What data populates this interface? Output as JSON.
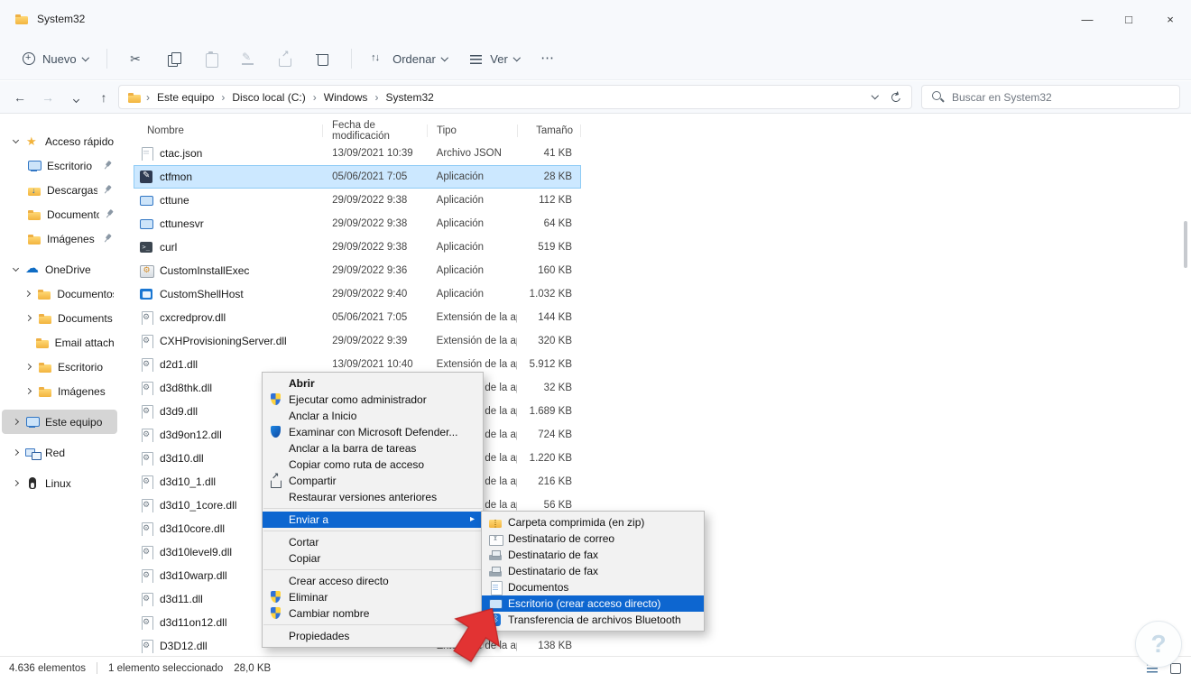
{
  "window": {
    "title": "System32",
    "controls": {
      "minimize": "—",
      "maximize": "□",
      "close": "×"
    }
  },
  "toolbar": {
    "new_label": "Nuevo",
    "sort_label": "Ordenar",
    "view_label": "Ver",
    "more_label": "⋯",
    "buttons": [
      {
        "icon": "cut",
        "enabled": true
      },
      {
        "icon": "copy",
        "enabled": true
      },
      {
        "icon": "paste",
        "enabled": false
      },
      {
        "icon": "rename",
        "enabled": false
      },
      {
        "icon": "share",
        "enabled": false
      },
      {
        "icon": "delete",
        "enabled": true
      }
    ]
  },
  "nav": {
    "buttons": [
      "back-arrow",
      "forward-arrow",
      "recent-locations-chevron",
      "up-arrow"
    ]
  },
  "address": {
    "crumbs": [
      "Este equipo",
      "Disco local (C:)",
      "Windows",
      "System32"
    ],
    "separator": "›",
    "search_placeholder": "Buscar en System32"
  },
  "sidebar": {
    "items": [
      {
        "label": "Acceso rápido",
        "icon": "star",
        "chevron": "down",
        "indent": 0
      },
      {
        "label": "Escritorio",
        "icon": "monitor",
        "indent": 1,
        "pinned": true
      },
      {
        "label": "Descargas",
        "icon": "folder-down",
        "indent": 1,
        "pinned": true
      },
      {
        "label": "Documentos",
        "icon": "folder",
        "indent": 1,
        "pinned": true
      },
      {
        "label": "Imágenes",
        "icon": "folder",
        "indent": 1,
        "pinned": true,
        "gap_after": true
      },
      {
        "label": "OneDrive",
        "icon": "cloud",
        "chevron": "down",
        "indent": 0
      },
      {
        "label": "Documentos",
        "icon": "folder",
        "chevron": "right",
        "indent": 1
      },
      {
        "label": "Documents",
        "icon": "folder",
        "chevron": "right",
        "indent": 1
      },
      {
        "label": "Email attachments",
        "icon": "folder",
        "chevron_spacer": true,
        "indent": 1
      },
      {
        "label": "Escritorio",
        "icon": "folder",
        "chevron": "right",
        "indent": 1
      },
      {
        "label": "Imágenes",
        "icon": "folder",
        "chevron": "right",
        "indent": 1,
        "gap_after": true
      },
      {
        "label": "Este equipo",
        "icon": "pc",
        "chevron": "right",
        "indent": 0,
        "selected": true,
        "gap_after": true
      },
      {
        "label": "Red",
        "icon": "network",
        "chevron": "right",
        "indent": 0,
        "gap_after": true
      },
      {
        "label": "Linux",
        "icon": "linux",
        "chevron": "right",
        "indent": 0
      }
    ]
  },
  "files": {
    "columns": [
      "Nombre",
      "Fecha de modificación",
      "Tipo",
      "Tamaño"
    ],
    "rows": [
      {
        "name": "ctac.json",
        "date": "13/09/2021 10:39",
        "type": "Archivo JSON",
        "size": "41 KB",
        "icon": "file"
      },
      {
        "name": "ctfmon",
        "date": "05/06/2021 7:05",
        "type": "Aplicación",
        "size": "28 KB",
        "icon": "app-pen",
        "selected": true
      },
      {
        "name": "cttune",
        "date": "29/09/2022 9:38",
        "type": "Aplicación",
        "size": "112 KB",
        "icon": "app-monitor"
      },
      {
        "name": "cttunesvr",
        "date": "29/09/2022 9:38",
        "type": "Aplicación",
        "size": "64 KB",
        "icon": "app-monitor"
      },
      {
        "name": "curl",
        "date": "29/09/2022 9:38",
        "type": "Aplicación",
        "size": "519 KB",
        "icon": "app-terminal"
      },
      {
        "name": "CustomInstallExec",
        "date": "29/09/2022 9:36",
        "type": "Aplicación",
        "size": "160 KB",
        "icon": "app-installer"
      },
      {
        "name": "CustomShellHost",
        "date": "29/09/2022 9:40",
        "type": "Aplicación",
        "size": "1.032 KB",
        "icon": "app-window"
      },
      {
        "name": "cxcredprov.dll",
        "date": "05/06/2021 7:05",
        "type": "Extensión de la ap...",
        "size": "144 KB",
        "icon": "dll"
      },
      {
        "name": "CXHProvisioningServer.dll",
        "date": "29/09/2022 9:39",
        "type": "Extensión de la ap...",
        "size": "320 KB",
        "icon": "dll"
      },
      {
        "name": "d2d1.dll",
        "date": "13/09/2021 10:40",
        "type": "Extensión de la ap...",
        "size": "5.912 KB",
        "icon": "dll"
      },
      {
        "name": "d3d8thk.dll",
        "date": "",
        "type": "Extensión de la ap...",
        "size": "32 KB",
        "icon": "dll"
      },
      {
        "name": "d3d9.dll",
        "date": "",
        "type": "Extensión de la ap...",
        "size": "1.689 KB",
        "icon": "dll"
      },
      {
        "name": "d3d9on12.dll",
        "date": "",
        "type": "Extensión de la ap...",
        "size": "724 KB",
        "icon": "dll"
      },
      {
        "name": "d3d10.dll",
        "date": "",
        "type": "Extensión de la ap...",
        "size": "1.220 KB",
        "icon": "dll"
      },
      {
        "name": "d3d10_1.dll",
        "date": "",
        "type": "Extensión de la ap...",
        "size": "216 KB",
        "icon": "dll"
      },
      {
        "name": "d3d10_1core.dll",
        "date": "",
        "type": "Extensión de la ap...",
        "size": "56 KB",
        "icon": "dll"
      },
      {
        "name": "d3d10core.dll",
        "date": "",
        "type": "",
        "size": "",
        "icon": "dll"
      },
      {
        "name": "d3d10level9.dll",
        "date": "",
        "type": "",
        "size": "",
        "icon": "dll"
      },
      {
        "name": "d3d10warp.dll",
        "date": "",
        "type": "",
        "size": "",
        "icon": "dll"
      },
      {
        "name": "d3d11.dll",
        "date": "",
        "type": "",
        "size": "",
        "icon": "dll"
      },
      {
        "name": "d3d11on12.dll",
        "date": "",
        "type": "",
        "size": "",
        "icon": "dll"
      },
      {
        "name": "D3D12.dll",
        "date": "",
        "type": "Extensión de la ap...",
        "size": "138 KB",
        "icon": "dll"
      }
    ]
  },
  "context_menu": {
    "submenu_arrow": "▸",
    "items": [
      {
        "label": "Abrir",
        "bold": true
      },
      {
        "label": "Ejecutar como administrador",
        "icon": "uac-shield"
      },
      {
        "label": "Anclar a Inicio"
      },
      {
        "label": "Examinar con Microsoft Defender...",
        "icon": "defender-shield"
      },
      {
        "label": "Anclar a la barra de tareas"
      },
      {
        "label": "Copiar como ruta de acceso"
      },
      {
        "label": "Compartir",
        "icon": "share"
      },
      {
        "label": "Restaurar versiones anteriores"
      },
      {
        "separator": true
      },
      {
        "label": "Enviar a",
        "highlighted": true,
        "submenu": true
      },
      {
        "separator": true
      },
      {
        "label": "Cortar"
      },
      {
        "label": "Copiar"
      },
      {
        "separator": true
      },
      {
        "label": "Crear acceso directo"
      },
      {
        "label": "Eliminar",
        "icon": "uac-shield"
      },
      {
        "label": "Cambiar nombre",
        "icon": "uac-shield"
      },
      {
        "separator": true
      },
      {
        "label": "Propiedades"
      }
    ]
  },
  "send_to_menu": {
    "items": [
      {
        "label": "Carpeta comprimida (en zip)",
        "icon": "zip"
      },
      {
        "label": "Destinatario de correo",
        "icon": "mail"
      },
      {
        "label": "Destinatario de fax",
        "icon": "fax"
      },
      {
        "label": "Destinatario de fax",
        "icon": "fax"
      },
      {
        "label": "Documentos",
        "icon": "doc"
      },
      {
        "label": "Escritorio (crear acceso directo)",
        "icon": "desktop",
        "highlighted": true
      },
      {
        "label": "Transferencia de archivos Bluetooth",
        "icon": "bluetooth"
      }
    ]
  },
  "status_bar": {
    "count": "4.636 elementos",
    "selection": "1 elemento seleccionado",
    "selection_size": "28,0 KB",
    "view_icons": [
      "details-view",
      "large-icons-view"
    ]
  },
  "watermark": {
    "glyph": "?"
  },
  "colors": {
    "menu_highlight": "#0d66d0",
    "selection_bg": "#cce8ff",
    "selection_border": "#8ecbf5",
    "arrow_color": "#e23333"
  }
}
